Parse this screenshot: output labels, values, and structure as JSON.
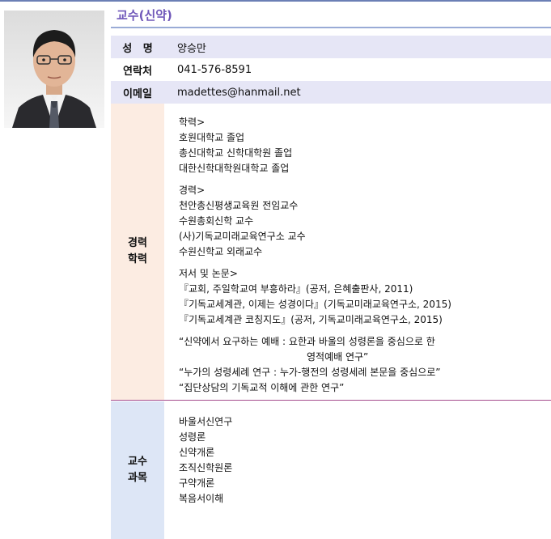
{
  "section_title": "교수(신약)",
  "info": {
    "name_label": "성   명",
    "name": "양승만",
    "phone_label": "연락처",
    "phone": "041-576-8591",
    "email_label": "이메일",
    "email": "madettes@hanmail.net"
  },
  "career": {
    "label_line1": "경력",
    "label_line2": "학력",
    "education_heading": "학력>",
    "education": [
      "호원대학교 졸업",
      "총신대학교 신학대학원 졸업",
      "대한신학대학원대학교 졸업"
    ],
    "experience_heading": "경력>",
    "experience": [
      "천안총신평생교육원 전임교수",
      "수원총회신학 교수",
      "(사)기독교미래교육연구소 교수",
      "수원신학교 외래교수"
    ],
    "works_heading": "저서 및 논문>",
    "works": [
      "『교회, 주일학교여 부흥하라』(공저, 은혜출판사, 2011)",
      "『기독교세계관, 이제는 성경이다』(기독교미래교육연구소, 2015)",
      "『기독교세계관 코칭지도』(공저, 기독교미래교육연구소, 2015)"
    ],
    "papers": [
      "“신약에서 요구하는 예배 : 요한과 바울의 성령론을 중심으로 한",
      "영적예배 연구”",
      "“누가의 성령세례 연구 : 누가-행전의 성령세례 본문을 중심으로”",
      "“집단상담의 기독교적 이해에 관한 연구”"
    ]
  },
  "courses": {
    "label_line1": "교수",
    "label_line2": "과목",
    "items": [
      "바울서신연구",
      "성령론",
      "신약개론",
      "조직신학원론",
      "구약개론",
      "복음서이해"
    ]
  }
}
